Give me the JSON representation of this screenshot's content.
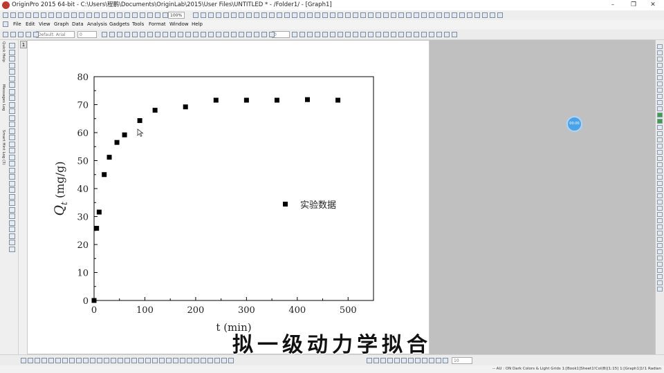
{
  "window": {
    "title": "OriginPro 2015 64-bit - C:\\Users\\程鹏\\Documents\\OriginLab\\2015\\User Files\\UNTITLED * - /Folder1/ - [Graph1]",
    "minimize": "–",
    "maximize": "❐",
    "close": "✕"
  },
  "toolbar": {
    "zoom": "100%",
    "font": "Default: Arial",
    "font_size": "0",
    "line_width": "0",
    "font_size2": "10"
  },
  "menu": [
    "File",
    "Edit",
    "View",
    "Graph",
    "Data",
    "Analysis",
    "Gadgets",
    "Tools",
    "Format",
    "Window",
    "Help"
  ],
  "sidebar": {
    "tabs": [
      "Quick Help",
      "Messages Log",
      "Smart Hint Log (3)"
    ],
    "layer_label": "1"
  },
  "cursor": {
    "label": "00:00"
  },
  "chart_data": {
    "type": "scatter",
    "xlabel": "t (min)",
    "ylabel_symbol": "Q",
    "ylabel_subscript": "t",
    "ylabel_unit": " (mg/g)",
    "xlim": [
      0,
      550
    ],
    "ylim": [
      0,
      80
    ],
    "xticks": [
      0,
      100,
      200,
      300,
      400,
      500
    ],
    "yticks": [
      0,
      10,
      20,
      30,
      40,
      50,
      60,
      70,
      80
    ],
    "series": [
      {
        "name": "实验数据",
        "marker": "square",
        "color": "#000000",
        "x": [
          0,
          5,
          10,
          20,
          30,
          45,
          60,
          90,
          120,
          180,
          240,
          300,
          360,
          420,
          480
        ],
        "y": [
          0,
          25.8,
          31.6,
          45,
          51.2,
          56.5,
          59.2,
          64.3,
          68,
          69.2,
          71.6,
          71.6,
          71.6,
          71.8,
          71.6
        ]
      }
    ],
    "legend": "right-center"
  },
  "status": {
    "text": "-- AU : ON  Dark Colors & Light Grids  1:[Book1]Sheet1!Col(B)[1:15]  1:[Graph1]1!1  Radian"
  },
  "subtitle": "拟一级动力学拟合"
}
